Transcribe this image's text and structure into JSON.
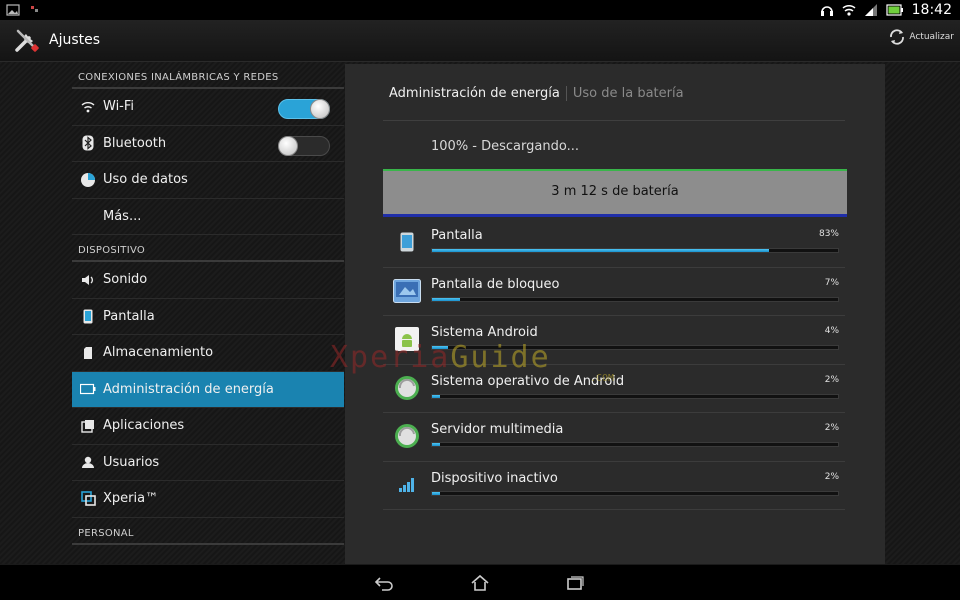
{
  "status_bar": {
    "time": "18:42"
  },
  "action_bar": {
    "title": "Ajustes",
    "refresh_label": "Actualizar"
  },
  "sections": {
    "wireless": "CONEXIONES INALÁMBRICAS Y REDES",
    "device": "DISPOSITIVO",
    "personal": "PERSONAL"
  },
  "wireless_items": [
    {
      "label": "Wi-Fi",
      "icon": "wifi-icon",
      "toggle": "on"
    },
    {
      "label": "Bluetooth",
      "icon": "bluetooth-icon",
      "toggle": "off"
    },
    {
      "label": "Uso de datos",
      "icon": "data-usage-icon"
    },
    {
      "label": "Más..."
    }
  ],
  "device_items": [
    {
      "label": "Sonido",
      "icon": "sound-icon"
    },
    {
      "label": "Pantalla",
      "icon": "display-icon"
    },
    {
      "label": "Almacenamiento",
      "icon": "storage-icon"
    },
    {
      "label": "Administración de energía",
      "icon": "power-icon",
      "active": true
    },
    {
      "label": "Aplicaciones",
      "icon": "apps-icon"
    },
    {
      "label": "Usuarios",
      "icon": "users-icon"
    },
    {
      "label": "Xperia™",
      "icon": "xperia-icon"
    }
  ],
  "panel": {
    "tab_active": "Administración de energía",
    "tab_inactive": "Uso de la batería",
    "status": "100% - Descargando...",
    "battery_time": "3 m 12 s de batería",
    "usage": [
      {
        "label": "Pantalla",
        "percent": "83%",
        "fraction": 0.83,
        "icon": "screen-icon"
      },
      {
        "label": "Pantalla de bloqueo",
        "percent": "7%",
        "fraction": 0.07,
        "icon": "lockscreen-icon"
      },
      {
        "label": "Sistema Android",
        "percent": "4%",
        "fraction": 0.04,
        "icon": "android-icon"
      },
      {
        "label": "Sistema operativo de Android",
        "percent": "2%",
        "fraction": 0.02,
        "icon": "android-os-icon"
      },
      {
        "label": "Servidor multimedia",
        "percent": "2%",
        "fraction": 0.02,
        "icon": "mediaserver-icon"
      },
      {
        "label": "Dispositivo inactivo",
        "percent": "2%",
        "fraction": 0.02,
        "icon": "cell-standby-icon"
      }
    ]
  },
  "watermark": {
    "text_a": "Xperia",
    "text_b": "Guide",
    "sub": ".COM"
  },
  "colors": {
    "accent": "#1a83b0",
    "bar": "#2aa3d7"
  }
}
